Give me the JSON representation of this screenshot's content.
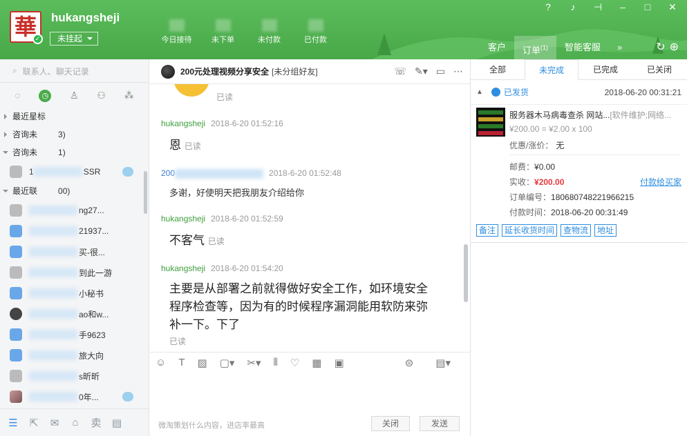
{
  "header": {
    "username": "hukangsheji",
    "status": "未挂起",
    "stats": [
      "今日接待",
      "未下单",
      "未付款",
      "已付款"
    ],
    "tabs": [
      {
        "label": "客户",
        "badge": ""
      },
      {
        "label": "订单",
        "badge": "(1)"
      },
      {
        "label": "智能客服",
        "badge": ""
      }
    ]
  },
  "left": {
    "search_placeholder": "联系人、聊天记录",
    "groups": {
      "starred": "最近星标",
      "consult_a": "咨询未",
      "consult_a_count": "3)",
      "consult_b": "咨询未",
      "consult_b_count": "1)",
      "recent": "最近联",
      "recent_count": "00)"
    },
    "contacts": [
      {
        "name_prefix": "1",
        "name": "SSR"
      },
      {
        "name_prefix": "",
        "name": "ng27..."
      },
      {
        "name_prefix": "",
        "name": "21937..."
      },
      {
        "name_prefix": "",
        "name": "买-很..."
      },
      {
        "name_prefix": "",
        "name": "到此一游"
      },
      {
        "name_prefix": "",
        "name": "小秘书"
      },
      {
        "name_prefix": "",
        "name": "ao和w..."
      },
      {
        "name_prefix": "",
        "name": "手9623"
      },
      {
        "name_prefix": "",
        "name": "旅大向"
      },
      {
        "name_prefix": "",
        "name": "s昕昕"
      },
      {
        "name_prefix": "",
        "name": "0年..."
      }
    ],
    "bottom_sell": "卖"
  },
  "chat": {
    "title": "200元处理视频分享安全",
    "group": "[未分组好友]",
    "read_label": "已读",
    "messages": [
      {
        "sender": "hukangsheji",
        "time": "2018-6-20 01:52:16",
        "text": "恩",
        "read": "已读"
      },
      {
        "sender_prefix": "200",
        "time": "2018-6-20 01:52:48",
        "text": "多谢，好使明天把我朋友介绍给你",
        "read": ""
      },
      {
        "sender": "hukangsheji",
        "time": "2018-6-20 01:52:59",
        "text": "不客气",
        "read": "已读"
      },
      {
        "sender": "hukangsheji",
        "time": "2018-6-20 01:54:20",
        "text": "主要是从部署之前就得做好安全工作，如环境安全 程序检查等，因为有的时候程序漏洞能用软防来弥补一下。下了",
        "read": "已读"
      }
    ],
    "input_hint": "微淘策划什么内容，进店率最高",
    "close_label": "关闭",
    "send_label": "发送"
  },
  "orders": {
    "tabs": [
      "全部",
      "未完成",
      "已完成",
      "已关闭"
    ],
    "active_tab": 1,
    "status": "已发货",
    "time": "2018-06-20 00:31:21",
    "product_title": "服务器木马病毒查杀 网站...",
    "product_category": "[软件维护;网络...",
    "price_line": "¥200.00 = ¥2.00 x 100",
    "discount_label": "优惠/涨价：",
    "discount_value": "无",
    "postage_label": "邮费：",
    "postage_value": "¥0.00",
    "paid_label": "实收：",
    "paid_value": "¥200.00",
    "paid_link": "付款给买家",
    "order_no_label": "订单编号：",
    "order_no": "180680748221966215",
    "pay_time_label": "付款时间：",
    "pay_time": "2018-06-20 00:31:49",
    "actions": [
      "备注",
      "延长收货时间",
      "查物流",
      "地址"
    ]
  }
}
